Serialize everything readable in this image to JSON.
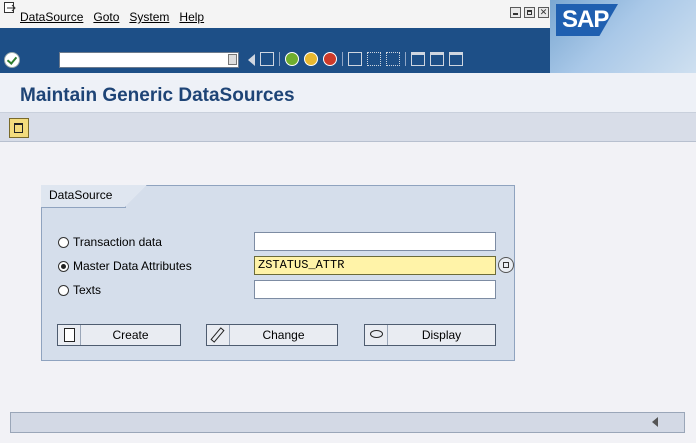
{
  "menu": {
    "items": [
      "DataSource",
      "Goto",
      "System",
      "Help"
    ]
  },
  "toolbar": {
    "command_field_value": ""
  },
  "title": "Maintain Generic DataSources",
  "group": {
    "label": "DataSource",
    "options": [
      {
        "label": "Transaction data",
        "selected": false,
        "value": ""
      },
      {
        "label": "Master Data Attributes",
        "selected": true,
        "value": "ZSTATUS_ATTR"
      },
      {
        "label": "Texts",
        "selected": false,
        "value": ""
      }
    ]
  },
  "buttons": {
    "create": "Create",
    "change": "Change",
    "display": "Display"
  },
  "brand": {
    "logo_text": "SAP",
    "accent": "#1d4f87"
  }
}
